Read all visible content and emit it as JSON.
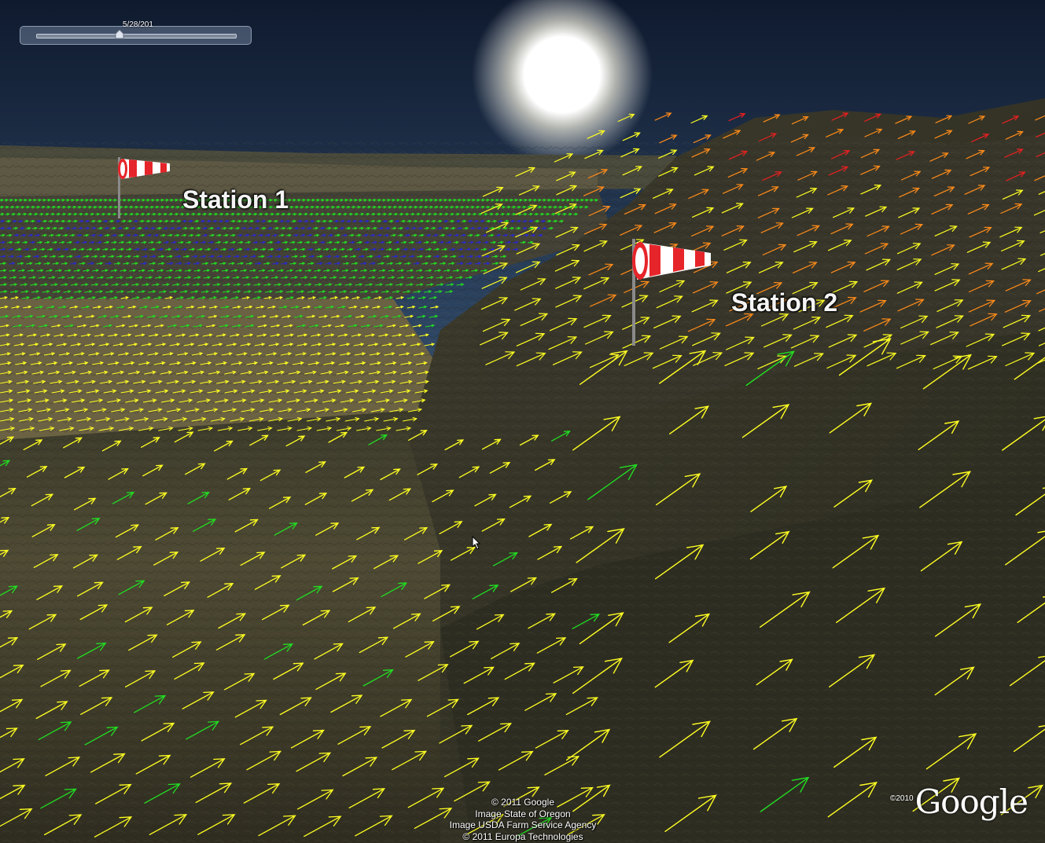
{
  "time_slider": {
    "date_label": "5/28/201",
    "position_fraction": 0.42
  },
  "stations": [
    {
      "label": "Station 1"
    },
    {
      "label": "Station 2"
    }
  ],
  "attribution": [
    "© 2011 Google",
    "Image State of Oregon",
    "Image USDA Farm Service Agency",
    "© 2011 Europa Technologies"
  ],
  "logo": {
    "year": "©2010",
    "text": "Google"
  },
  "wind_colors": {
    "calm": "#2a2acc",
    "light": "#22dd22",
    "moderate": "#ffff22",
    "strong": "#ff8c1a",
    "gale": "#e82020"
  },
  "icons": {
    "windsock": "windsock-icon",
    "cursor": "mouse-pointer-icon",
    "sun": "sun-icon"
  }
}
